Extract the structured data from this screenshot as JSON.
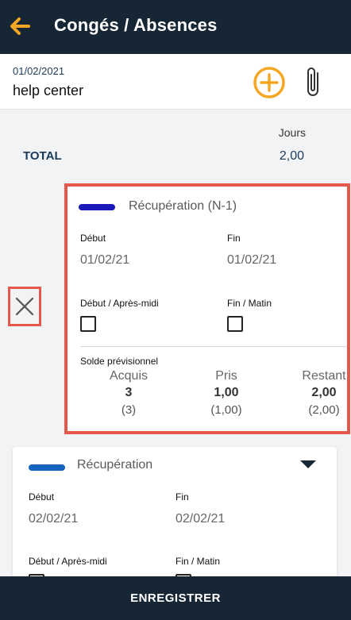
{
  "header": {
    "title": "Congés / Absences",
    "back_icon": "arrow-left-icon",
    "accent": "#f5a623",
    "background": "#172635"
  },
  "info": {
    "date": "01/02/2021",
    "name": "help center",
    "add_icon": "plus-circle-icon",
    "attach_icon": "paperclip-icon"
  },
  "summary": {
    "column_header": "Jours",
    "total_label": "TOTAL",
    "total_value": "2,00"
  },
  "entries": [
    {
      "type": "Récupération (N-1)",
      "bar_color": "#1a1ab8",
      "start_label": "Début",
      "start_value": "01/02/21",
      "end_label": "Fin",
      "end_value": "01/02/21",
      "start_half_label": "Début / Après-midi",
      "start_half_checked": false,
      "end_half_label": "Fin / Matin",
      "end_half_checked": false,
      "solde": {
        "label": "Solde prévisionnel",
        "acquis": {
          "label": "Acquis",
          "value": "3",
          "sub": "(3)"
        },
        "pris": {
          "label": "Pris",
          "value": "1,00",
          "sub": "(1,00)"
        },
        "restant": {
          "label": "Restant",
          "value": "2,00",
          "sub": "(2,00)"
        }
      }
    },
    {
      "type": "Récupération",
      "bar_color": "#1565c0",
      "start_label": "Début",
      "start_value": "02/02/21",
      "end_label": "Fin",
      "end_value": "02/02/21",
      "start_half_label": "Début / Après-midi",
      "end_half_label": "Fin / Matin"
    }
  ],
  "footer": {
    "save_label": "ENREGISTRER"
  },
  "highlight_color": "#e5574a"
}
